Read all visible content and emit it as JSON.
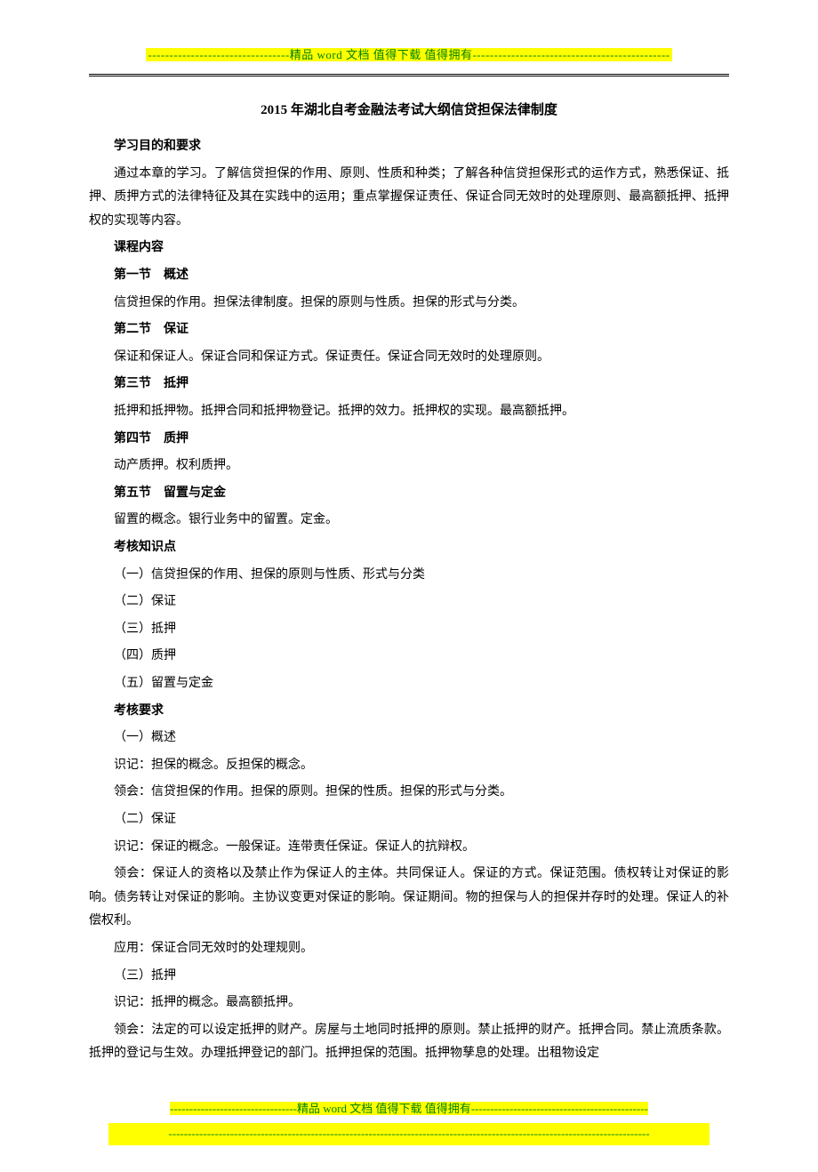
{
  "header": {
    "banner": "---------------------------------精品 word 文档   值得下载   值得拥有----------------------------------------------"
  },
  "title": "2015 年湖北自考金融法考试大纲信贷担保法律制度",
  "body": {
    "h_objective": "学习目的和要求",
    "p_objective": "通过本章的学习。了解信贷担保的作用、原则、性质和种类；了解各种信贷担保形式的运作方式，熟悉保证、抵押、质押方式的法律特征及其在实践中的运用；重点掌握保证责任、保证合同无效时的处理原则、最高额抵押、抵押权的实现等内容。",
    "h_content": "课程内容",
    "s1_h": "第一节　概述",
    "s1_p": "信贷担保的作用。担保法律制度。担保的原则与性质。担保的形式与分类。",
    "s2_h": "第二节　保证",
    "s2_p": "保证和保证人。保证合同和保证方式。保证责任。保证合同无效时的处理原则。",
    "s3_h": "第三节　抵押",
    "s3_p": "抵押和抵押物。抵押合同和抵押物登记。抵押的效力。抵押权的实现。最高额抵押。",
    "s4_h": "第四节　质押",
    "s4_p": "动产质押。权利质押。",
    "s5_h": "第五节　留置与定金",
    "s5_p": "留置的概念。银行业务中的留置。定金。",
    "h_points": "考核知识点",
    "pt1": "（一）信贷担保的作用、担保的原则与性质、形式与分类",
    "pt2": "（二）保证",
    "pt3": "（三）抵押",
    "pt4": "（四）质押",
    "pt5": "（五）留置与定金",
    "h_req": "考核要求",
    "r1_h": "（一）概述",
    "r1_a": "识记：担保的概念。反担保的概念。",
    "r1_b": "领会：信贷担保的作用。担保的原则。担保的性质。担保的形式与分类。",
    "r2_h": "（二）保证",
    "r2_a": "识记：保证的概念。一般保证。连带责任保证。保证人的抗辩权。",
    "r2_b": "领会：保证人的资格以及禁止作为保证人的主体。共同保证人。保证的方式。保证范围。债权转让对保证的影响。债务转让对保证的影响。主协议变更对保证的影响。保证期间。物的担保与人的担保并存时的处理。保证人的补偿权利。",
    "r2_c": "应用：保证合同无效时的处理规则。",
    "r3_h": "（三）抵押",
    "r3_a": "识记：抵押的概念。最高额抵押。",
    "r3_b": "领会：法定的可以设定抵押的财产。房屋与土地同时抵押的原则。禁止抵押的财产。抵押合同。禁止流质条款。抵押的登记与生效。办理抵押登记的部门。抵押担保的范围。抵押物孳息的处理。出租物设定"
  },
  "footer": {
    "line1": "---------------------------------精品 word 文档   值得下载   值得拥有----------------------------------------------",
    "line2": "-----------------------------------------------------------------------------------------------------------------------------"
  }
}
